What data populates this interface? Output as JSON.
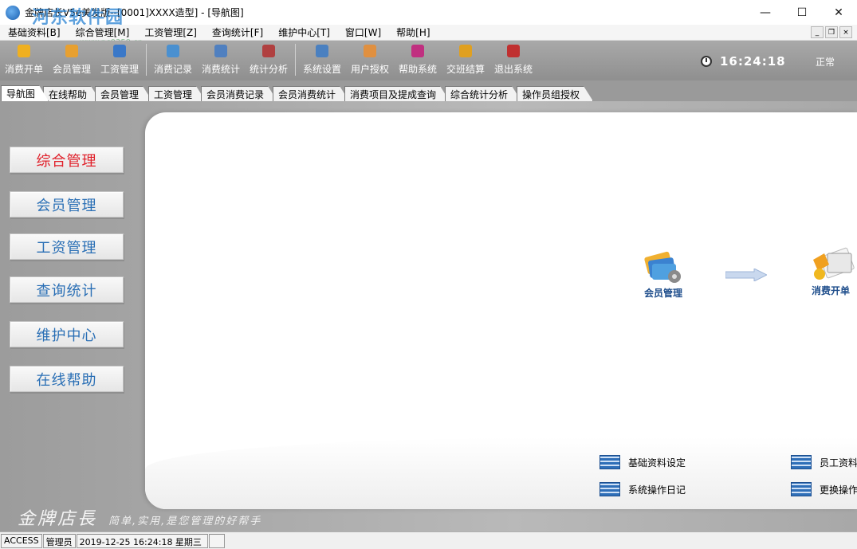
{
  "window": {
    "title": "金牌店长V5e美发版--[0001]XXXX造型] - [导航图]",
    "watermark": "河东软件园",
    "watermark_url": "www.pc0359.cn",
    "controls": {
      "minimize": "—",
      "maximize": "☐",
      "close": "✕"
    }
  },
  "menu": {
    "items": [
      "基础资料[B]",
      "综合管理[M]",
      "工资管理[Z]",
      "查询统计[F]",
      "维护中心[T]",
      "窗口[W]",
      "帮助[H]"
    ],
    "mdi_controls": [
      "_",
      "❐",
      "×"
    ]
  },
  "toolbar": {
    "buttons": [
      {
        "label": "消费开单",
        "icon": "yen-coin-icon",
        "color": "#f0b020"
      },
      {
        "label": "会员管理",
        "icon": "member-icon",
        "color": "#e8a030"
      },
      {
        "label": "工资管理",
        "icon": "payroll-icon",
        "color": "#3a78c8"
      },
      {
        "label": "消费记录",
        "icon": "record-icon",
        "color": "#4a90d0"
      },
      {
        "label": "消费统计",
        "icon": "stats-icon",
        "color": "#5080c0"
      },
      {
        "label": "统计分析",
        "icon": "analysis-icon",
        "color": "#b04040"
      },
      {
        "label": "系统设置",
        "icon": "settings-icon",
        "color": "#4a80c0"
      },
      {
        "label": "用户授权",
        "icon": "user-auth-icon",
        "color": "#e09040"
      },
      {
        "label": "帮助系统",
        "icon": "help-book-icon",
        "color": "#c03080"
      },
      {
        "label": "交班结算",
        "icon": "handover-icon",
        "color": "#e0a020"
      },
      {
        "label": "退出系统",
        "icon": "exit-icon",
        "color": "#c03030"
      }
    ],
    "separator_after": [
      2,
      5
    ],
    "clock": "16:24:18",
    "status": "正常"
  },
  "tabs": [
    {
      "label": "导航图",
      "active": true
    },
    {
      "label": "在线帮助"
    },
    {
      "label": "会员管理"
    },
    {
      "label": "工资管理"
    },
    {
      "label": "会员消费记录"
    },
    {
      "label": "会员消费统计"
    },
    {
      "label": "消费项目及提成查询"
    },
    {
      "label": "综合统计分析"
    },
    {
      "label": "操作员组授权"
    }
  ],
  "nav": {
    "buttons": [
      "综合管理",
      "会员管理",
      "工资管理",
      "查询统计",
      "维护中心",
      "在线帮助"
    ]
  },
  "flow": {
    "member": "会员管理",
    "billing": "消费开单"
  },
  "quick_links": [
    "基础资料设定",
    "员工资料",
    "系统操作日记",
    "更换操作"
  ],
  "brand": {
    "name": "金牌店長",
    "slogan": "简单,实用,是您管理的好帮手"
  },
  "statusbar": {
    "db": "ACCESS",
    "user": "管理员",
    "datetime": "2019-12-25 16:24:18 星期三"
  }
}
